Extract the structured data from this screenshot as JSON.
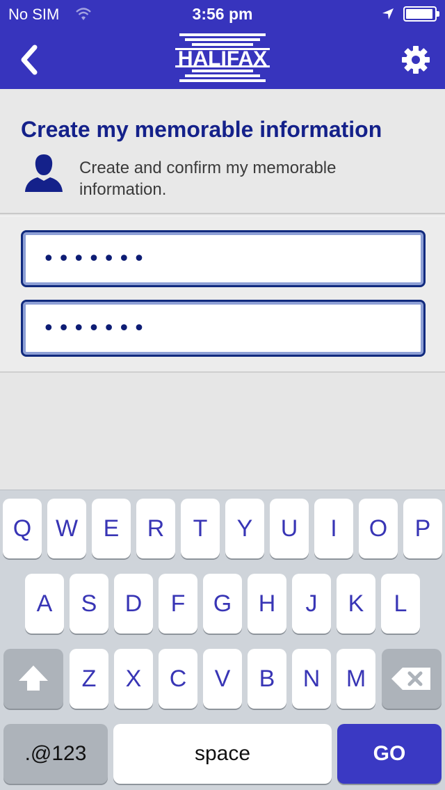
{
  "status": {
    "carrier": "No SIM",
    "time": "3:56 pm",
    "battery_level": 0.95,
    "icons": [
      "wifi-icon",
      "location-arrow-icon",
      "battery-icon"
    ]
  },
  "nav": {
    "logo": "HALIFAX",
    "icons": [
      "chevron-left-icon",
      "gear-icon"
    ],
    "accent_color": "#3734bd"
  },
  "header": {
    "title": "Create my memorable information",
    "subtitle": "Create and confirm my memorable information.",
    "icon": "person-silhouette-icon",
    "title_color": "#14218a"
  },
  "form": {
    "memorable_info_value": "•••••••",
    "confirm_memorable_info_value": "•••••••"
  },
  "keyboard": {
    "row1": [
      "Q",
      "W",
      "E",
      "R",
      "T",
      "Y",
      "U",
      "I",
      "O",
      "P"
    ],
    "row2": [
      "A",
      "S",
      "D",
      "F",
      "G",
      "H",
      "J",
      "K",
      "L"
    ],
    "row3": [
      "Z",
      "X",
      "C",
      "V",
      "B",
      "N",
      "M"
    ],
    "numbers_label": ".@123",
    "space_label": "space",
    "go_label": "GO",
    "icons": [
      "shift-arrow-icon",
      "backspace-icon"
    ]
  }
}
